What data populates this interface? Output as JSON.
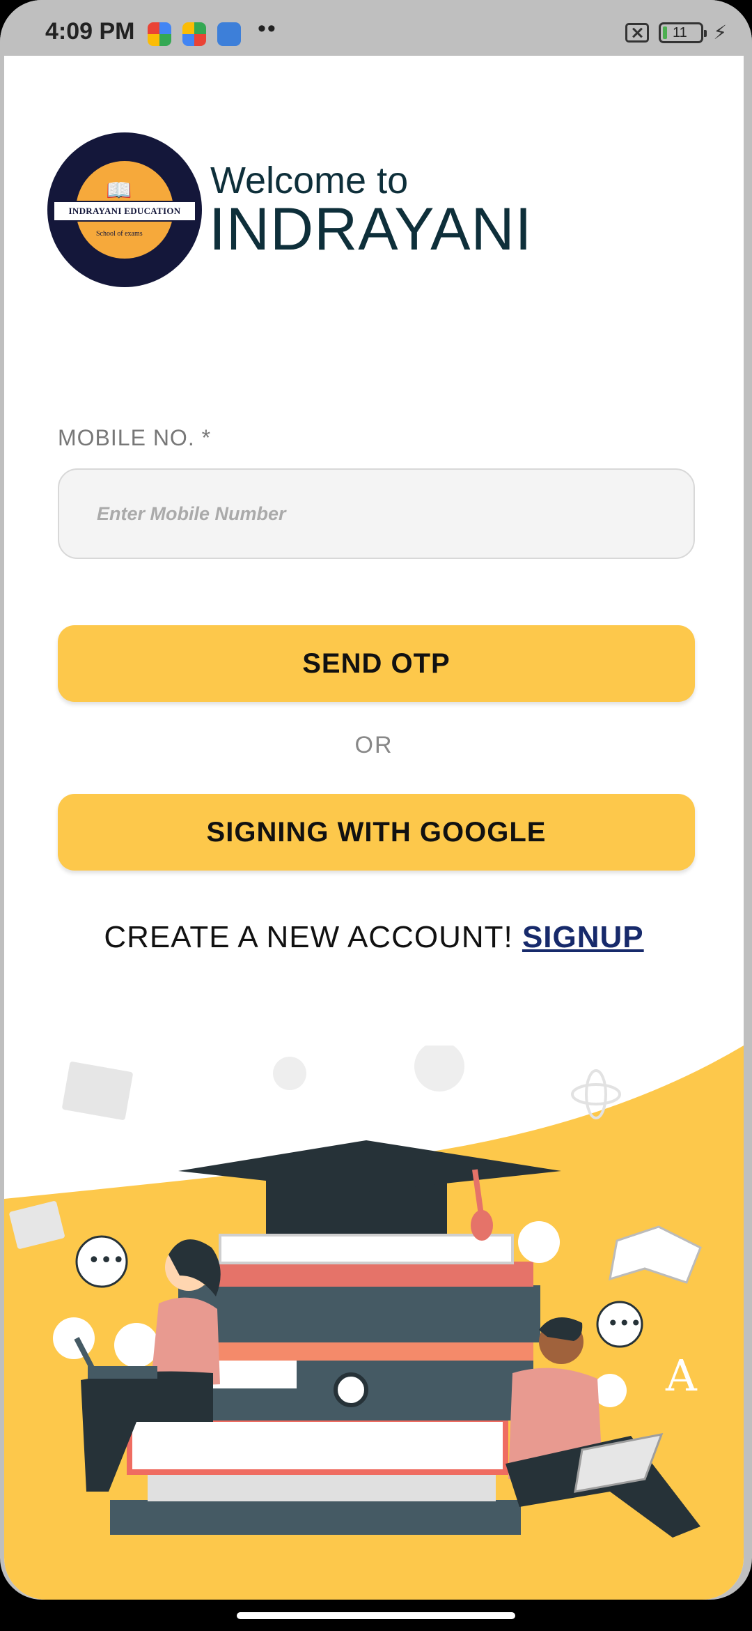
{
  "status_bar": {
    "time": "4:09 PM",
    "dots": "••",
    "battery_level": "11",
    "battery_fraction": 0.11
  },
  "header": {
    "logo_text": "INDRAYANI EDUCATION",
    "logo_subtext": "School of exams",
    "welcome": "Welcome to",
    "brand": "INDRAYANI"
  },
  "form": {
    "mobile_label": "MOBILE NO. *",
    "mobile_placeholder": "Enter Mobile Number",
    "mobile_value": "",
    "send_otp_label": "SEND OTP",
    "or_label": "OR",
    "google_label": "SIGNING WITH GOOGLE"
  },
  "signup": {
    "prompt": "CREATE A NEW ACCOUNT! ",
    "link": "SIGNUP"
  },
  "colors": {
    "accent": "#fdc84b",
    "brand_text": "#0e2f3a",
    "link": "#172a6b",
    "logo_navy": "#14173a",
    "logo_orange": "#f6a93b"
  }
}
